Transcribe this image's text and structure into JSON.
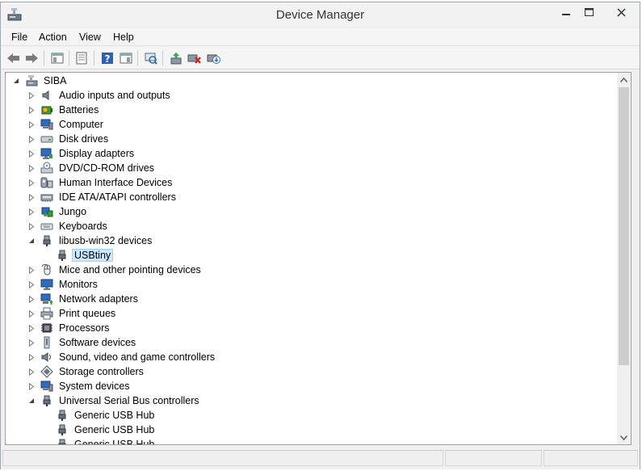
{
  "window": {
    "title": "Device Manager"
  },
  "menu": [
    {
      "label": "File"
    },
    {
      "label": "Action"
    },
    {
      "label": "View"
    },
    {
      "label": "Help"
    }
  ],
  "toolbar": [
    {
      "icon": "back-arrow-icon"
    },
    {
      "icon": "forward-arrow-icon"
    },
    {
      "icon": "show-hide-console-tree-icon"
    },
    {
      "icon": "properties-icon"
    },
    {
      "icon": "help-icon"
    },
    {
      "icon": "show-action-pane-icon"
    },
    {
      "icon": "scan-hardware-changes-icon"
    },
    {
      "icon": "update-driver-icon"
    },
    {
      "icon": "uninstall-device-icon"
    },
    {
      "icon": "add-legacy-hardware-icon"
    }
  ],
  "tree": {
    "root": {
      "label": "SIBA",
      "icon": "computer-root-icon"
    },
    "items": [
      {
        "label": "Audio inputs and outputs",
        "icon": "speaker-icon",
        "state": "collapsed",
        "level": 1
      },
      {
        "label": "Batteries",
        "icon": "battery-icon",
        "state": "collapsed",
        "level": 1
      },
      {
        "label": "Computer",
        "icon": "computer-icon",
        "state": "collapsed",
        "level": 1
      },
      {
        "label": "Disk drives",
        "icon": "disk-drive-icon",
        "state": "collapsed",
        "level": 1
      },
      {
        "label": "Display adapters",
        "icon": "display-adapter-icon",
        "state": "collapsed",
        "level": 1
      },
      {
        "label": "DVD/CD-ROM drives",
        "icon": "dvd-drive-icon",
        "state": "collapsed",
        "level": 1
      },
      {
        "label": "Human Interface Devices",
        "icon": "hid-icon",
        "state": "collapsed",
        "level": 1
      },
      {
        "label": "IDE ATA/ATAPI controllers",
        "icon": "ide-controller-icon",
        "state": "collapsed",
        "level": 1
      },
      {
        "label": "Jungo",
        "icon": "jungo-icon",
        "state": "collapsed",
        "level": 1
      },
      {
        "label": "Keyboards",
        "icon": "keyboard-icon",
        "state": "collapsed",
        "level": 1
      },
      {
        "label": "libusb-win32 devices",
        "icon": "usb-plug-icon",
        "state": "expanded",
        "level": 1
      },
      {
        "label": "USBtiny",
        "icon": "usb-plug-icon",
        "state": "leaf",
        "level": 2,
        "selected": true
      },
      {
        "label": "Mice and other pointing devices",
        "icon": "mouse-icon",
        "state": "collapsed",
        "level": 1
      },
      {
        "label": "Monitors",
        "icon": "monitor-icon",
        "state": "collapsed",
        "level": 1
      },
      {
        "label": "Network adapters",
        "icon": "network-adapter-icon",
        "state": "collapsed",
        "level": 1
      },
      {
        "label": "Print queues",
        "icon": "printer-icon",
        "state": "collapsed",
        "level": 1
      },
      {
        "label": "Processors",
        "icon": "processor-icon",
        "state": "collapsed",
        "level": 1
      },
      {
        "label": "Software devices",
        "icon": "software-device-icon",
        "state": "collapsed",
        "level": 1
      },
      {
        "label": "Sound, video and game controllers",
        "icon": "sound-controller-icon",
        "state": "collapsed",
        "level": 1
      },
      {
        "label": "Storage controllers",
        "icon": "storage-controller-icon",
        "state": "collapsed",
        "level": 1
      },
      {
        "label": "System devices",
        "icon": "system-device-icon",
        "state": "collapsed",
        "level": 1
      },
      {
        "label": "Universal Serial Bus controllers",
        "icon": "usb-plug-icon",
        "state": "expanded",
        "level": 1
      },
      {
        "label": "Generic USB Hub",
        "icon": "usb-plug-icon",
        "state": "leaf",
        "level": 2
      },
      {
        "label": "Generic USB Hub",
        "icon": "usb-plug-icon",
        "state": "leaf",
        "level": 2
      },
      {
        "label": "Generic USB Hub",
        "icon": "usb-plug-icon",
        "state": "leaf",
        "level": 2
      }
    ]
  },
  "colors": {
    "selection_bg": "#cce8ff",
    "selection_border": "#99d1ff"
  }
}
